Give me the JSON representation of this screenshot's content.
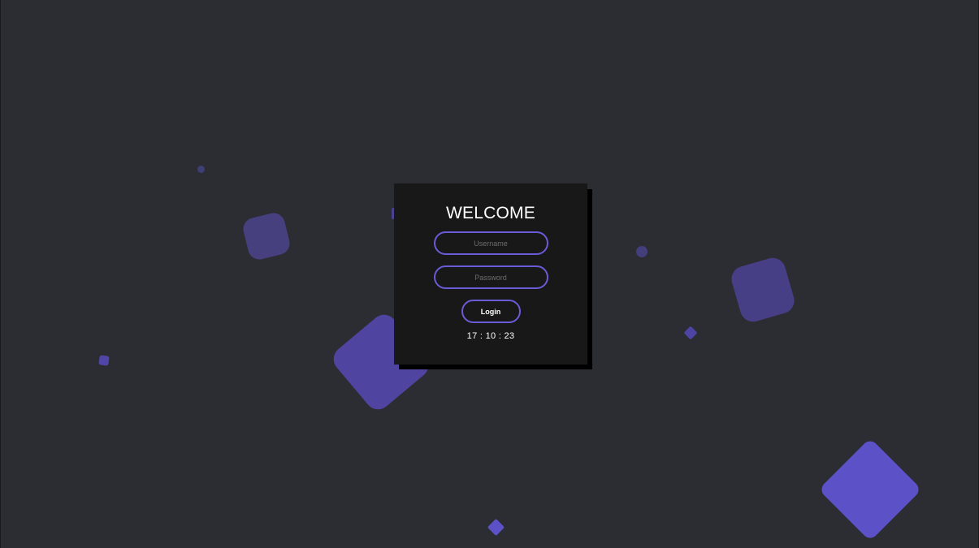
{
  "login": {
    "title": "WELCOME",
    "username_placeholder": "Username",
    "password_placeholder": "Password",
    "login_label": "Login",
    "clock": "17 : 10 : 23"
  },
  "theme": {
    "background": "#2b2d33",
    "card": "#181818",
    "accent": "#6a5bd6",
    "shape": "#5c51c7"
  }
}
